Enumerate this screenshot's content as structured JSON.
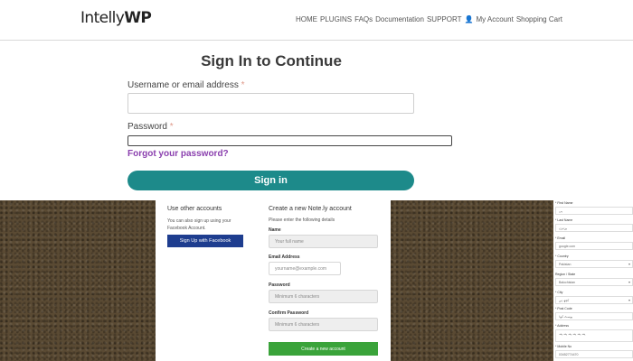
{
  "header": {
    "logo_part1": "Intelly",
    "logo_part2": "WP",
    "nav": [
      "HOME",
      "PLUGINS",
      "FAQs",
      "Documentation",
      "SUPPORT",
      "My Account",
      "Shopping Cart"
    ],
    "user_icon": "👤"
  },
  "signin": {
    "title": "Sign In to Continue",
    "username_label": "Username or email address",
    "password_label": "Password",
    "required_mark": "*",
    "forgot_link": "Forgot your password?",
    "submit_label": "Sign in"
  },
  "social": {
    "other_heading": "Use other accounts",
    "other_desc_line1": "You can also sign up using your",
    "other_desc_line2": "Facebook Account.",
    "facebook_button": "Sign Up with Facebook",
    "create_heading": "Create a new Note.ly account",
    "create_desc": "Please enter the following details",
    "name_label": "Name",
    "name_placeholder": "Your full name",
    "email_label": "Email Address",
    "email_placeholder": "yourname@example.com",
    "password_label": "Password",
    "password_placeholder": "Minimum 6 characters",
    "confirm_label": "Confirm Password",
    "confirm_placeholder": "Minimum 6 characters",
    "create_button": "Create a new account"
  },
  "right_form": {
    "fields": [
      {
        "label": "* First Name",
        "value": "پی"
      },
      {
        "label": "* Last Name",
        "value": "پن‌ترن"
      },
      {
        "label": "* Email",
        "value": "google.com"
      },
      {
        "label": "* Country",
        "value": "Pakistan",
        "select": true
      },
      {
        "label": "Region / State",
        "value": "Balochistan",
        "select": true
      },
      {
        "label": "* City",
        "value": "کچھ ہے",
        "select": true
      },
      {
        "label": "* Post Code",
        "value": "پوسٹ کوڈ"
      },
      {
        "label": "* Address",
        "value": "پتہ پتہ پتہ پتہ پتہ پتہ"
      },
      {
        "label": "* Mobile No",
        "value": "03452774470"
      }
    ]
  },
  "colors": {
    "accent_teal": "#1d8a8a",
    "link_purple": "#8a3fae",
    "facebook_blue": "#1e3d8f",
    "create_green": "#3aa33a"
  }
}
